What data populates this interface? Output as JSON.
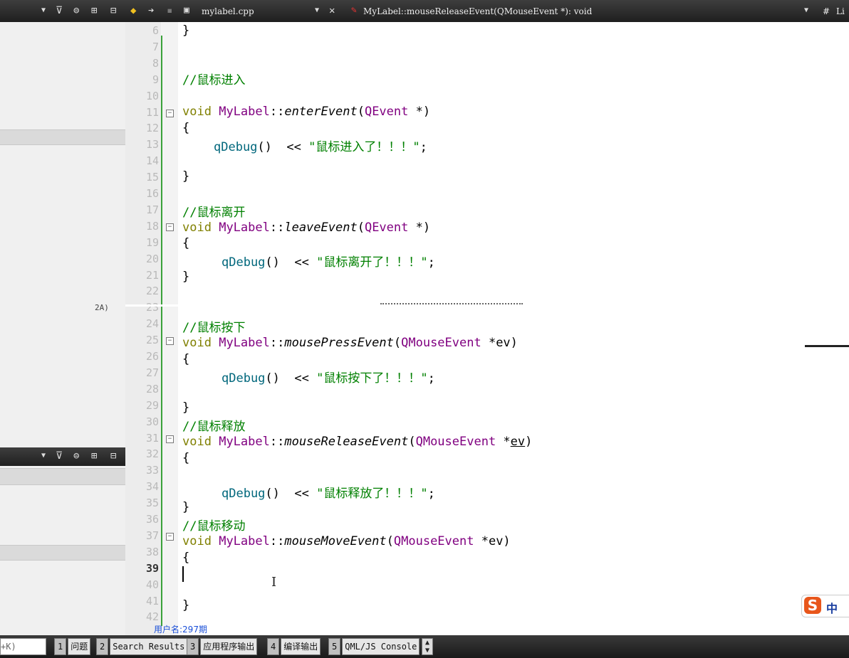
{
  "editor_toolbar": {
    "file_name": "mylabel.cpp",
    "function_signature": "MyLabel::mouseReleaseEvent(QMouseEvent *): void",
    "hash_label": "#",
    "line_label": "Li"
  },
  "left_panel": {
    "tool_icons": [
      "filter-icon",
      "link-icon",
      "split-icon",
      "close-icon"
    ]
  },
  "code_lines": [
    {
      "n": "6",
      "text": "}"
    },
    {
      "n": "7",
      "text": ""
    },
    {
      "n": "8",
      "text": ""
    },
    {
      "n": "9",
      "text": "//鼠标进入"
    },
    {
      "n": "10",
      "text": ""
    },
    {
      "n": "11",
      "text": "void MyLabel::enterEvent(QEvent *)"
    },
    {
      "n": "12",
      "text": "{"
    },
    {
      "n": "13",
      "text": "qDebug()  << \"鼠标进入了！！！\";"
    },
    {
      "n": "14",
      "text": ""
    },
    {
      "n": "15",
      "text": "}"
    },
    {
      "n": "16",
      "text": ""
    },
    {
      "n": "17",
      "text": "//鼠标离开"
    },
    {
      "n": "18",
      "text": "void MyLabel::leaveEvent(QEvent *)"
    },
    {
      "n": "19",
      "text": "{"
    },
    {
      "n": "20",
      "text": "qDebug()  << \"鼠标离开了！！！\";"
    },
    {
      "n": "21",
      "text": "}"
    },
    {
      "n": "22",
      "text": ""
    },
    {
      "n": "23",
      "text": ""
    },
    {
      "n": "24",
      "text": "//鼠标按下"
    },
    {
      "n": "25",
      "text": "void MyLabel::mousePressEvent(QMouseEvent *ev)"
    },
    {
      "n": "26",
      "text": "{"
    },
    {
      "n": "27",
      "text": "qDebug()  << \"鼠标按下了！！！\";"
    },
    {
      "n": "28",
      "text": ""
    },
    {
      "n": "29",
      "text": "}"
    },
    {
      "n": "30",
      "text": "//鼠标释放"
    },
    {
      "n": "31",
      "text": "void MyLabel::mouseReleaseEvent(QMouseEvent *ev)"
    },
    {
      "n": "32",
      "text": "{"
    },
    {
      "n": "33",
      "text": ""
    },
    {
      "n": "34",
      "text": "qDebug()  << \"鼠标释放了！！！\";"
    },
    {
      "n": "35",
      "text": "}"
    },
    {
      "n": "36",
      "text": "//鼠标移动"
    },
    {
      "n": "37",
      "text": "void MyLabel::mouseMoveEvent(QMouseEvent *ev)"
    },
    {
      "n": "38",
      "text": "{"
    },
    {
      "n": "39",
      "text": ""
    },
    {
      "n": "40",
      "text": ""
    },
    {
      "n": "41",
      "text": "}"
    },
    {
      "n": "42",
      "text": ""
    }
  ],
  "current_line": "39",
  "fold_lines": [
    "11",
    "18",
    "25",
    "31",
    "37"
  ],
  "watermark": "用户名:297期",
  "ime": {
    "logo": "S",
    "mode": "中"
  },
  "bottom_bar": {
    "search_text": "+K)",
    "tabs": [
      {
        "num": "1",
        "label": "问题"
      },
      {
        "num": "2",
        "label": "Search Results"
      },
      {
        "num": "3",
        "label": "应用程序输出"
      },
      {
        "num": "4",
        "label": "编译输出"
      },
      {
        "num": "5",
        "label": "QML/JS Console"
      }
    ]
  },
  "colors": {
    "keyword": "#808000",
    "class": "#800080",
    "string": "#008000",
    "comment": "#008000",
    "function_call": "#00677c",
    "change_marker": "#3aa13a"
  }
}
